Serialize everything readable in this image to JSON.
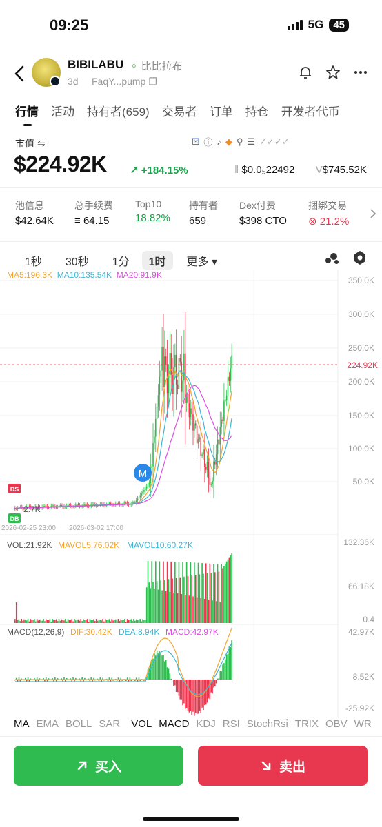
{
  "status": {
    "time": "09:25",
    "network": "5G",
    "battery": "45"
  },
  "token": {
    "name": "BIBILABU",
    "cn_name": "比比拉布",
    "age": "3d",
    "address": "FaqY...pump"
  },
  "tabs": [
    "行情",
    "活动",
    "持有者(659)",
    "交易者",
    "订单",
    "持仓",
    "开发者代币"
  ],
  "market": {
    "label": "市值 ⇋",
    "value": "$224.92K",
    "change": "↗ +184.15%",
    "price": "$0.0₅22492",
    "volume": "$745.52K"
  },
  "stats": [
    {
      "k": "池信息",
      "v": "$42.64K"
    },
    {
      "k": "总手续费",
      "v": "64.15"
    },
    {
      "k": "Top10",
      "v": "18.82%"
    },
    {
      "k": "持有者",
      "v": "659"
    },
    {
      "k": "Dex付费",
      "v": "$398 CTO"
    },
    {
      "k": "捆绑交易",
      "v": "21.2%"
    }
  ],
  "intervals": [
    "1秒",
    "30秒",
    "1分",
    "1时",
    "更多"
  ],
  "ma": {
    "ma5": "MA5:196.3K",
    "ma10": "MA10:135.54K",
    "ma20": "MA20:91.9K"
  },
  "vol_legend": {
    "vol": "VOL:21.92K",
    "mavol5": "MAVOL5:76.02K",
    "mavol10": "MAVOL10:60.27K"
  },
  "macd_legend": {
    "name": "MACD(12,26,9)",
    "dif": "DIF:30.42K",
    "dea": "DEA:8.94K",
    "macd": "MACD:42.97K"
  },
  "axes": {
    "price": [
      "350.0K",
      "300.0K",
      "250.0K",
      "200.0K",
      "150.0K",
      "100.0K",
      "50.0K"
    ],
    "current": "224.92K",
    "vol": [
      "132.36K",
      "66.18K",
      "0.4"
    ],
    "macd": [
      "42.97K",
      "8.52K",
      "-25.92K"
    ],
    "dates": [
      "2026-02-25 23:00",
      "2026-03-02 17:00"
    ],
    "low_marker": "2.7K"
  },
  "badges": {
    "ds": "DS",
    "db": "DB",
    "m": "M"
  },
  "indicators": [
    "MA",
    "EMA",
    "BOLL",
    "SAR",
    "VOL",
    "MACD",
    "KDJ",
    "RSI",
    "StochRsi",
    "TRIX",
    "OBV",
    "WR"
  ],
  "buttons": {
    "buy": "买入",
    "sell": "卖出"
  },
  "colors": {
    "up": "#2fbb4f",
    "down": "#e8384f",
    "ma5": "#f0a531",
    "ma10": "#3cb6d6",
    "ma20": "#d94fe0"
  }
}
